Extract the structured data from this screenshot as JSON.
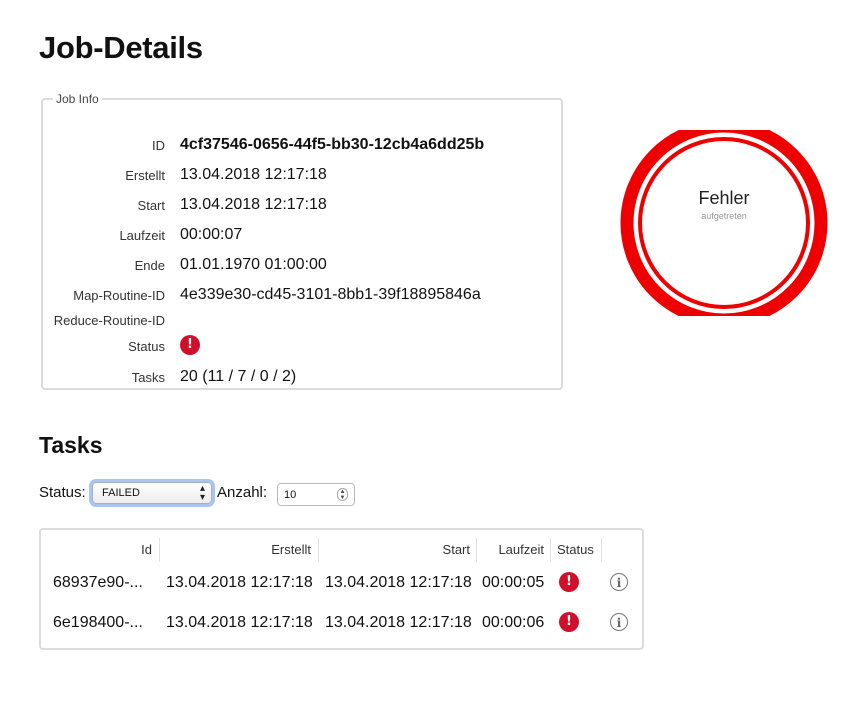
{
  "page_title": "Job-Details",
  "job_info": {
    "legend": "Job Info",
    "rows": [
      {
        "label": "ID",
        "value": "4cf37546-0656-44f5-bb30-12cb4a6dd25b"
      },
      {
        "label": "Erstellt",
        "value": "13.04.2018 12:17:18"
      },
      {
        "label": "Start",
        "value": "13.04.2018 12:17:18"
      },
      {
        "label": "Laufzeit",
        "value": "00:00:07"
      },
      {
        "label": "Ende",
        "value": "01.01.1970 01:00:00"
      },
      {
        "label": "Map-Routine-ID",
        "value": "4e339e30-cd45-3101-8bb1-39f18895846a"
      },
      {
        "label": "Reduce-Routine-ID",
        "value": ""
      },
      {
        "label": "Status",
        "value": ""
      },
      {
        "label": "Tasks",
        "value": "20 (11 / 7 / 0 / 2)"
      }
    ],
    "status_icon": "error-icon"
  },
  "status_ring": {
    "title": "Fehler",
    "subtitle": "aufgetreten",
    "color": "#ee0000"
  },
  "tasks": {
    "title": "Tasks",
    "status_label": "Status:",
    "status_selected": "FAILED",
    "count_label": "Anzahl:",
    "count_value": "10",
    "columns": [
      "Id",
      "Erstellt",
      "Start",
      "Laufzeit",
      "Status"
    ],
    "rows": [
      {
        "id": "68937e90-...",
        "created": "13.04.2018 12:17:18",
        "start": "13.04.2018 12:17:18",
        "duration": "00:00:05",
        "status_icon": "error-icon",
        "action_icon": "info-icon"
      },
      {
        "id": "6e198400-...",
        "created": "13.04.2018 12:17:18",
        "start": "13.04.2018 12:17:18",
        "duration": "00:00:06",
        "status_icon": "error-icon",
        "action_icon": "info-icon"
      }
    ]
  },
  "colors": {
    "error": "#d0102b",
    "border": "#dcdcdc",
    "focus": "#a9c7ee"
  }
}
